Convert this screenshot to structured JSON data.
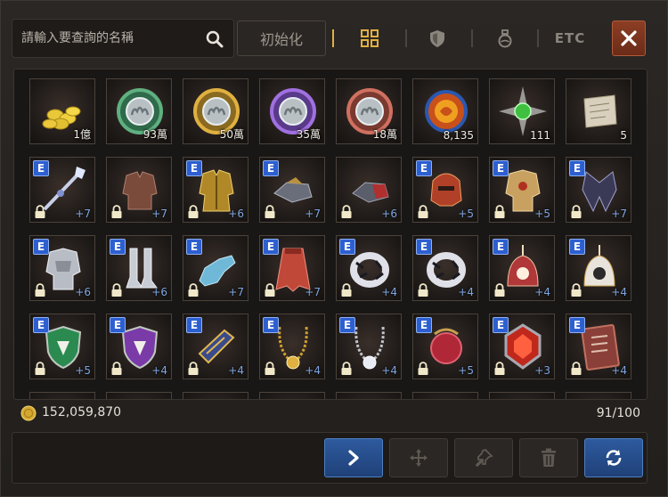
{
  "search": {
    "placeholder": "請輸入要查詢的名稱"
  },
  "toolbar": {
    "reset_label": "初始化",
    "tabs": [
      {
        "icon": "grid-icon",
        "active": true
      },
      {
        "icon": "shield-icon",
        "active": false
      },
      {
        "icon": "potion-icon",
        "active": false
      },
      {
        "label": "ETC",
        "active": false
      }
    ]
  },
  "inventory": {
    "rows": [
      [
        {
          "icon": "gold-coins-icon",
          "qty": "1億"
        },
        {
          "icon": "green-medal-icon",
          "qty": "93萬"
        },
        {
          "icon": "gold-medal-icon",
          "qty": "50萬"
        },
        {
          "icon": "purple-medal-icon",
          "qty": "35萬"
        },
        {
          "icon": "red-medal-icon",
          "qty": "18萬"
        },
        {
          "icon": "lion-emblem-icon",
          "qty": "8,135"
        },
        {
          "icon": "green-orb-star-icon",
          "qty": "111"
        },
        {
          "icon": "scroll-icon",
          "qty": "5"
        }
      ],
      [
        {
          "icon": "crystal-staff-icon",
          "equip": "E",
          "locked": true,
          "enhance": "+7"
        },
        {
          "icon": "leather-armor-icon",
          "equip": "",
          "locked": true,
          "enhance": "+7"
        },
        {
          "icon": "gold-robe-icon",
          "equip": "E",
          "locked": true,
          "enhance": "+6"
        },
        {
          "icon": "gauntlet-icon",
          "equip": "E",
          "locked": true,
          "enhance": "+7"
        },
        {
          "icon": "red-gauntlet-icon",
          "equip": "",
          "locked": true,
          "enhance": "+6"
        },
        {
          "icon": "red-helm-icon",
          "equip": "E",
          "locked": true,
          "enhance": "+5"
        },
        {
          "icon": "gold-armor-icon",
          "equip": "E",
          "locked": true,
          "enhance": "+5"
        },
        {
          "icon": "dark-cloak-icon",
          "equip": "E",
          "locked": true,
          "enhance": "+7"
        }
      ],
      [
        {
          "icon": "silver-armor-icon",
          "equip": "E",
          "locked": true,
          "enhance": "+6"
        },
        {
          "icon": "boots-icon",
          "equip": "E",
          "locked": true,
          "enhance": "+6"
        },
        {
          "icon": "gloves-icon",
          "equip": "E",
          "locked": true,
          "enhance": "+7"
        },
        {
          "icon": "red-cape-icon",
          "equip": "E",
          "locked": true,
          "enhance": "+7"
        },
        {
          "icon": "zebra-ring-icon",
          "equip": "E",
          "locked": true,
          "enhance": "+4"
        },
        {
          "icon": "zebra-ring-icon",
          "equip": "E",
          "locked": true,
          "enhance": "+4"
        },
        {
          "icon": "red-earring-icon",
          "equip": "E",
          "locked": true,
          "enhance": "+4"
        },
        {
          "icon": "white-earring-icon",
          "equip": "E",
          "locked": true,
          "enhance": "+4"
        }
      ],
      [
        {
          "icon": "green-shield-icon",
          "equip": "E",
          "locked": true,
          "enhance": "+5"
        },
        {
          "icon": "purple-shield-icon",
          "equip": "E",
          "locked": true,
          "enhance": "+4"
        },
        {
          "icon": "blue-bracer-icon",
          "equip": "E",
          "locked": true,
          "enhance": "+4"
        },
        {
          "icon": "gold-necklace-icon",
          "equip": "E",
          "locked": true,
          "enhance": "+4"
        },
        {
          "icon": "silver-necklace-icon",
          "equip": "E",
          "locked": true,
          "enhance": "+4"
        },
        {
          "icon": "red-orb-icon",
          "equip": "E",
          "locked": true,
          "enhance": "+5"
        },
        {
          "icon": "red-gem-icon",
          "equip": "E",
          "locked": true,
          "enhance": "+3"
        },
        {
          "icon": "tablet-icon",
          "equip": "E",
          "locked": true,
          "enhance": "+4"
        }
      ]
    ]
  },
  "footer": {
    "gold_amount": "152,059,870",
    "slot_count": "91/100"
  },
  "colors": {
    "accent": "#e0b040",
    "enhance": "#7fa6e0",
    "close": "#8c3e24",
    "action_blue": "#2e5a9e"
  }
}
